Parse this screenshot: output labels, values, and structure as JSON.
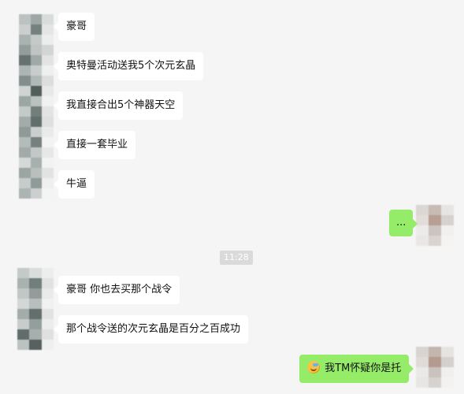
{
  "messages": [
    {
      "side": "left",
      "text": "豪哥"
    },
    {
      "side": "left",
      "text": "奥特曼活动送我5个次元玄晶"
    },
    {
      "side": "left",
      "text": "我直接合出5个神器天空"
    },
    {
      "side": "left",
      "text": "直接一套毕业"
    },
    {
      "side": "left",
      "text": "牛逼"
    },
    {
      "side": "right",
      "text": "..."
    },
    {
      "side": "left",
      "text": "豪哥 你也去买那个战令"
    },
    {
      "side": "left",
      "text": "那个战令送的次元玄晶是百分之百成功"
    },
    {
      "side": "right",
      "text": "我TM怀疑你是托",
      "emoji": "face-with-tears-emoji"
    }
  ],
  "timestamp": "11:28"
}
